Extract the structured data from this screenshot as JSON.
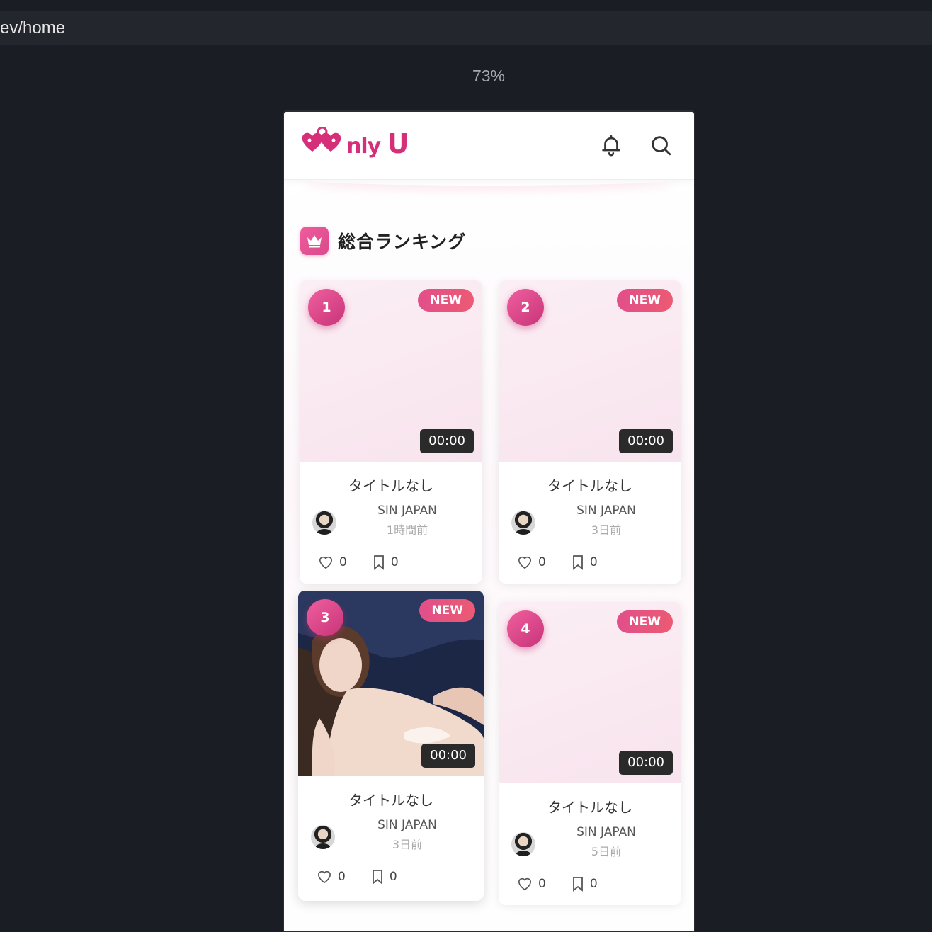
{
  "browser": {
    "url": "ev/home",
    "zoom": "73%"
  },
  "header": {
    "logo_text_nly": "nly",
    "logo_text_u": "U",
    "logo_word": "Only U"
  },
  "section": {
    "title": "総合ランキング"
  },
  "cards": [
    {
      "rank": "1",
      "badge": "NEW",
      "duration": "00:00",
      "title": "タイトルなし",
      "creator": "SIN JAPAN",
      "time": "1時間前",
      "likes": "0",
      "bookmarks": "0"
    },
    {
      "rank": "2",
      "badge": "NEW",
      "duration": "00:00",
      "title": "タイトルなし",
      "creator": "SIN JAPAN",
      "time": "3日前",
      "likes": "0",
      "bookmarks": "0"
    },
    {
      "rank": "3",
      "badge": "NEW",
      "duration": "00:00",
      "title": "タイトルなし",
      "creator": "SIN JAPAN",
      "time": "3日前",
      "likes": "0",
      "bookmarks": "0"
    },
    {
      "rank": "4",
      "badge": "NEW",
      "duration": "00:00",
      "title": "タイトルなし",
      "creator": "SIN JAPAN",
      "time": "5日前",
      "likes": "0",
      "bookmarks": "0"
    }
  ],
  "icons": {
    "bell": "bell-icon",
    "search": "search-icon",
    "crown": "crown-icon",
    "heart": "heart-icon",
    "bookmark": "bookmark-icon"
  },
  "colors": {
    "brand": "#d62f7a",
    "background": "#1b1d24"
  }
}
